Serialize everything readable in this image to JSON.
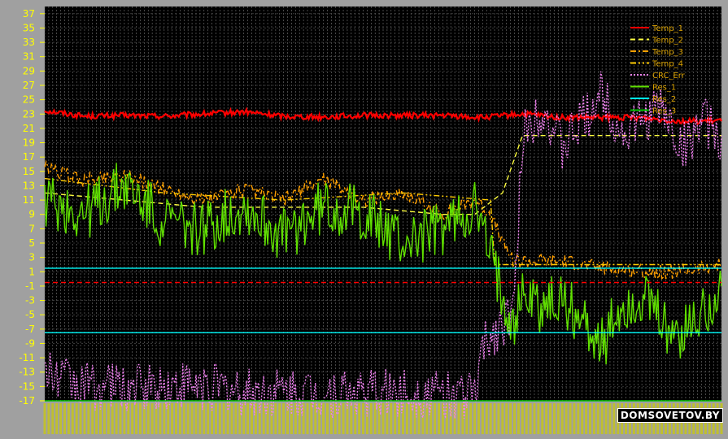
{
  "chart_data": {
    "type": "line",
    "title": "",
    "xlabel": "",
    "ylabel": "",
    "ylim": [
      -17,
      38
    ],
    "yticks": [
      37,
      35,
      33,
      31,
      29,
      27,
      25,
      23,
      21,
      19,
      17,
      15,
      13,
      11,
      9,
      7,
      5,
      3,
      1,
      -1,
      -3,
      -5,
      -7,
      -9,
      -11,
      -13,
      -15,
      -17
    ],
    "x_tick_count": 170,
    "grid": true,
    "legend_position": "top-right",
    "series": [
      {
        "name": "Temp_1",
        "color": "#ff0000",
        "style": "solid",
        "x": [
          0,
          10,
          20,
          30,
          40,
          50,
          60,
          70,
          80,
          90,
          100,
          110,
          120,
          130,
          140,
          150,
          160,
          170
        ],
        "values": [
          23.5,
          22.7,
          22.8,
          22.7,
          23.0,
          23.3,
          22.7,
          22.6,
          22.8,
          22.8,
          22.8,
          22.5,
          23.0,
          22.5,
          22.5,
          22.5,
          22.0,
          22.0
        ]
      },
      {
        "name": "Temp_2",
        "color": "#ffff40",
        "style": "dashed",
        "x": [
          0,
          20,
          40,
          60,
          80,
          100,
          108,
          115,
          120,
          130,
          140,
          150,
          160,
          170
        ],
        "values": [
          12,
          11,
          10,
          10,
          10,
          9,
          9,
          12,
          20,
          20,
          20,
          20,
          20,
          20
        ]
      },
      {
        "name": "Temp_3",
        "color": "#ffa000",
        "style": "dashdot",
        "x": [
          0,
          10,
          20,
          30,
          40,
          50,
          60,
          70,
          80,
          90,
          100,
          108,
          112,
          115,
          118,
          120,
          130,
          140,
          150,
          160,
          170
        ],
        "values": [
          15.5,
          13.8,
          14.5,
          12.5,
          11.0,
          12.5,
          11.0,
          14.0,
          11.0,
          12.0,
          9.0,
          11.0,
          9.0,
          5.0,
          2.5,
          2.5,
          2.5,
          1.5,
          1.0,
          1.0,
          2.0
        ]
      },
      {
        "name": "Temp_4",
        "color": "#ffcc00",
        "style": "dashdotdot",
        "x": [
          0,
          30,
          60,
          90,
          112,
          113,
          140,
          170
        ],
        "values": [
          14,
          12,
          11,
          12,
          11,
          2,
          2,
          2
        ]
      },
      {
        "name": "CRC_Err",
        "color": "#ee82ee",
        "style": "dotted",
        "x": [
          0,
          5,
          10,
          20,
          30,
          40,
          50,
          60,
          70,
          80,
          90,
          100,
          108,
          110,
          112,
          115,
          118,
          120,
          125,
          130,
          135,
          140,
          145,
          150,
          155,
          160,
          165,
          170
        ],
        "values": [
          -13,
          -14,
          -15,
          -15,
          -15,
          -15,
          -16,
          -16,
          -16,
          -16,
          -16,
          -16,
          -16,
          -10,
          -8,
          -6,
          -4,
          20,
          24,
          18,
          22,
          26,
          20,
          22,
          24,
          18,
          22,
          20
        ]
      },
      {
        "name": "Res_1",
        "color": "#60e000",
        "style": "solid",
        "x": [
          0,
          10,
          20,
          30,
          40,
          50,
          60,
          70,
          80,
          90,
          100,
          108,
          112,
          115,
          118,
          120,
          125,
          130,
          135,
          140,
          145,
          150,
          155,
          160,
          165,
          170
        ],
        "values": [
          11,
          9,
          13,
          8,
          7,
          10,
          6,
          10,
          9,
          5,
          7,
          10,
          3,
          -2,
          -6,
          -2,
          -4,
          -3,
          -6,
          -9,
          -4,
          -3,
          -6,
          -8,
          -5,
          -1
        ]
      },
      {
        "name": "Res_2",
        "color": "#00ffff",
        "style": "solid",
        "x": [
          0,
          170
        ],
        "values": [
          1.5,
          1.5
        ]
      },
      {
        "name": "Res_3",
        "color": "#00c000",
        "style": "solid",
        "x": [
          0,
          170
        ],
        "values": [
          -17,
          -17
        ]
      },
      {
        "name": "",
        "color": "#00ffff",
        "style": "solid",
        "x": [
          0,
          170
        ],
        "values": [
          -7.5,
          -7.5
        ]
      },
      {
        "name": "",
        "color": "#ff0000",
        "style": "dashed",
        "x": [
          0,
          170
        ],
        "values": [
          -0.5,
          -0.5
        ]
      }
    ],
    "legend": [
      "Temp_1",
      "Temp_2",
      "Temp_3",
      "Temp_4",
      "CRC_Err",
      "Res_1",
      "Res_2",
      "Res_3"
    ]
  },
  "watermark": "DOMSOVETOV.BY"
}
